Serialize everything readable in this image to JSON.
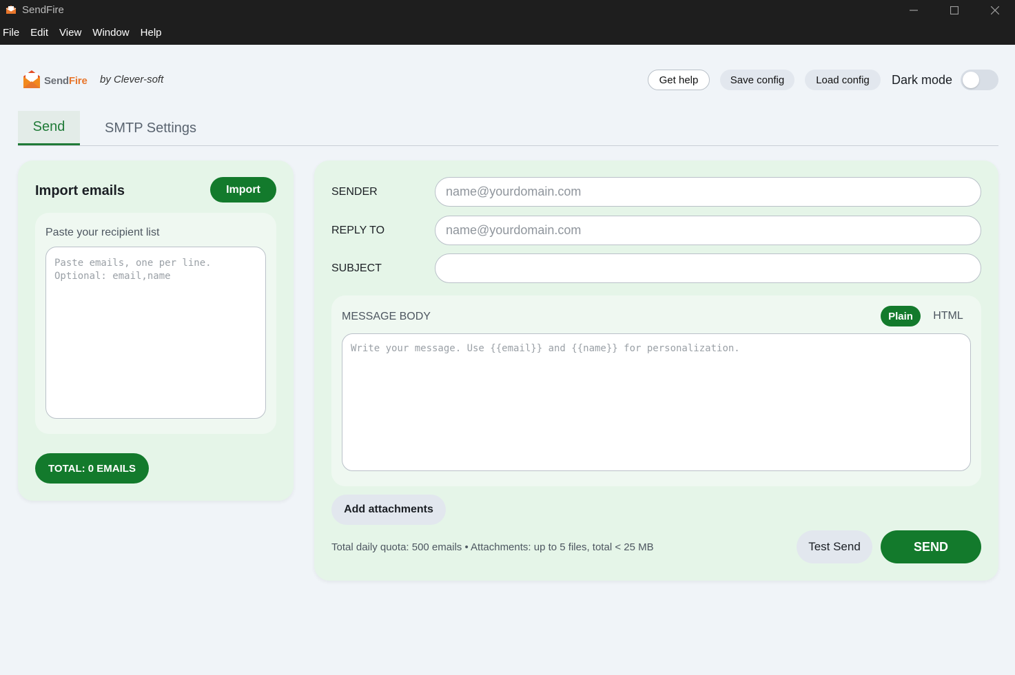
{
  "window": {
    "title": "SendFire",
    "icon": "sendfire-envelope-icon",
    "controls": [
      "minimize-icon",
      "maximize-icon",
      "close-icon"
    ]
  },
  "menu": [
    "File",
    "Edit",
    "View",
    "Window",
    "Help"
  ],
  "header": {
    "logo_send": "Send",
    "logo_fire": "Fire",
    "byline": "by Clever-soft",
    "get_help": "Get help",
    "save_config": "Save config",
    "load_config": "Load config",
    "dark_mode_label": "Dark mode",
    "dark_mode_on": false
  },
  "tabs": [
    {
      "label": "Send",
      "active": true
    },
    {
      "label": "SMTP Settings",
      "active": false
    }
  ],
  "import_panel": {
    "title": "Import emails",
    "import_button": "Import",
    "recipient_label": "Paste your recipient list",
    "recipient_placeholder": "Paste emails, one per line.\nOptional: email,name",
    "recipient_value": "",
    "total_label": "TOTAL: 0 EMAILS"
  },
  "compose": {
    "sender_label": "SENDER",
    "sender_placeholder": "name@yourdomain.com",
    "sender_value": "",
    "reply_to_label": "REPLY TO",
    "reply_to_placeholder": "name@yourdomain.com",
    "reply_to_value": "",
    "subject_label": "SUBJECT",
    "subject_value": "",
    "message_label": "MESSAGE BODY",
    "format_plain": "Plain",
    "format_html": "HTML",
    "format_selected": "Plain",
    "message_placeholder": "Write your message. Use {{email}} and {{name}} for personalization.",
    "message_value": "",
    "add_attachments": "Add attachments",
    "quota_text": "Total daily quota: 500 emails • Attachments: up to 5 files, total < 25 MB",
    "test_send": "Test Send",
    "send": "SEND"
  },
  "colors": {
    "accent_green": "#137a2c",
    "panel_green": "#e5f5e8",
    "brand_orange": "#e8762c",
    "titlebar": "#1e1e1e"
  }
}
